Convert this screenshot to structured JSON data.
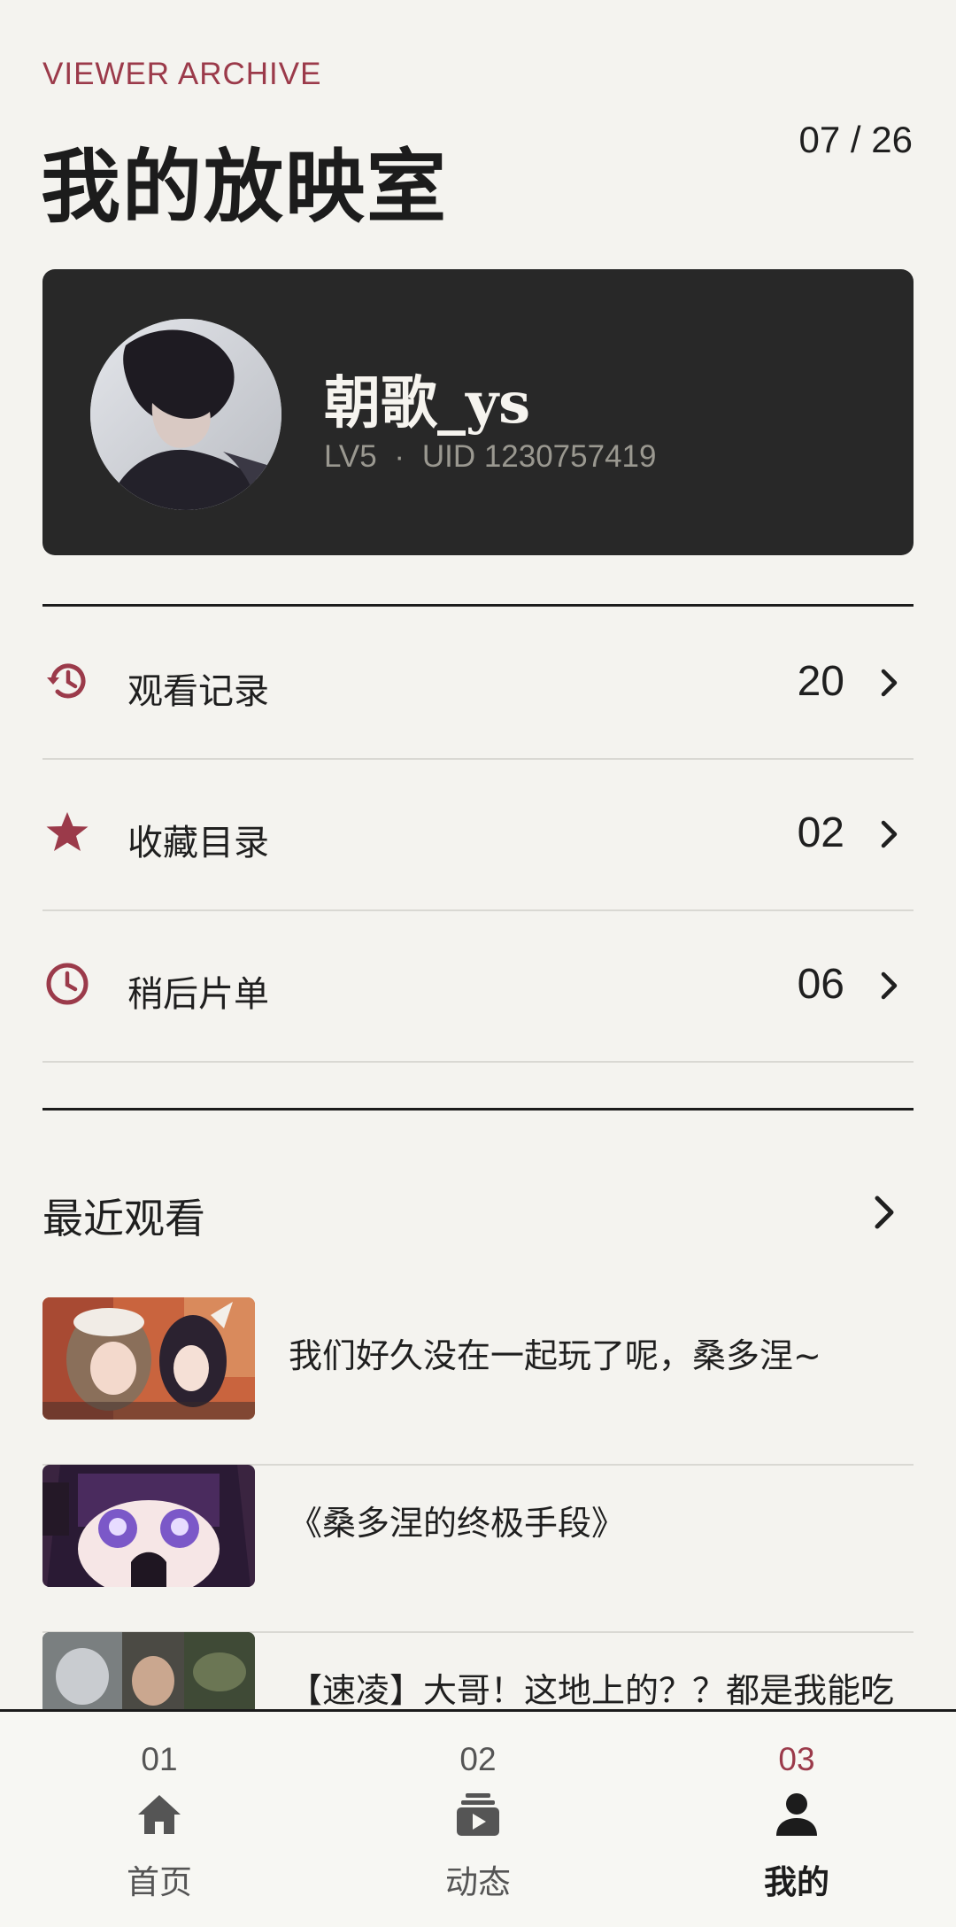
{
  "header": {
    "eyebrow": "VIEWER ARCHIVE",
    "title": "我的放映室",
    "date": "07 / 26"
  },
  "profile": {
    "username": "朝歌_ys",
    "level": "LV5",
    "separator": "·",
    "uid": "UID 1230757419"
  },
  "menu": [
    {
      "label": "观看记录",
      "count": "20",
      "icon": "history-icon"
    },
    {
      "label": "收藏目录",
      "count": "02",
      "icon": "star-icon"
    },
    {
      "label": "稍后片单",
      "count": "06",
      "icon": "clock-icon"
    }
  ],
  "recent": {
    "title": "最近观看",
    "items": [
      {
        "title": "我们好久没在一起玩了呢，桑多涅~"
      },
      {
        "title": "《桑多涅的终极手段》"
      },
      {
        "title": "【速凌】大哥！这地上的？？都是我能吃的吗？？？"
      }
    ]
  },
  "tabs": [
    {
      "num": "01",
      "label": "首页",
      "icon": "home-icon"
    },
    {
      "num": "02",
      "label": "动态",
      "icon": "feed-icon"
    },
    {
      "num": "03",
      "label": "我的",
      "icon": "user-icon",
      "active": true
    }
  ],
  "colors": {
    "accent": "#9b3a4a",
    "card": "#282828",
    "background": "#f4f3ef"
  }
}
